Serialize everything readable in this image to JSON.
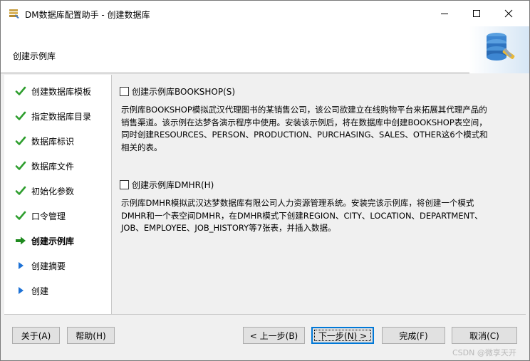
{
  "window": {
    "title": "DM数据库配置助手 - 创建数据库",
    "controls": {
      "minimize": "minimize-icon",
      "maximize": "maximize-icon",
      "close": "close-icon"
    }
  },
  "header": {
    "title": "创建示例库",
    "logo": "database-config-logo"
  },
  "nav": {
    "items": [
      {
        "label": "创建数据库模板",
        "state": "done"
      },
      {
        "label": "指定数据库目录",
        "state": "done"
      },
      {
        "label": "数据库标识",
        "state": "done"
      },
      {
        "label": "数据库文件",
        "state": "done"
      },
      {
        "label": "初始化参数",
        "state": "done"
      },
      {
        "label": "口令管理",
        "state": "done"
      },
      {
        "label": "创建示例库",
        "state": "current"
      },
      {
        "label": "创建摘要",
        "state": "pending"
      },
      {
        "label": "创建",
        "state": "pending"
      }
    ]
  },
  "options": [
    {
      "label": "创建示例库BOOKSHOP(S)",
      "checked": false,
      "description": [
        "示例库BOOKSHOP模拟武汉代理图书的某销售公司，该公司欲建立在线购物平台来拓展其代理产品的",
        "销售渠道。该示例在达梦各演示程序中使用。安装该示例后，将在数据库中创建BOOKSHOP表空间，",
        "同时创建RESOURCES、PERSON、PRODUCTION、PURCHASING、SALES、OTHER这6个模式和",
        "相关的表。"
      ]
    },
    {
      "label": "创建示例库DMHR(H)",
      "checked": false,
      "description": [
        "示例库DMHR模拟武汉达梦数据库有限公司人力资源管理系统。安装完该示例库，将创建一个模式",
        "DMHR和一个表空间DMHR，在DMHR模式下创建REGION、CITY、LOCATION、DEPARTMENT、",
        "JOB、EMPLOYEE、JOB_HISTORY等7张表，并插入数据。"
      ]
    }
  ],
  "buttons": {
    "about": "关于(A)",
    "help": "帮助(H)",
    "back": "< 上一步(B)",
    "next": "下一步(N) >",
    "finish": "完成(F)",
    "cancel": "取消(C)"
  },
  "colors": {
    "check_green": "#2e9e2e",
    "arrow_green": "#1f8a1f",
    "pending_blue": "#1e72d6",
    "default_button_border": "#0078d7"
  },
  "watermark": "CSDN @微享天开"
}
